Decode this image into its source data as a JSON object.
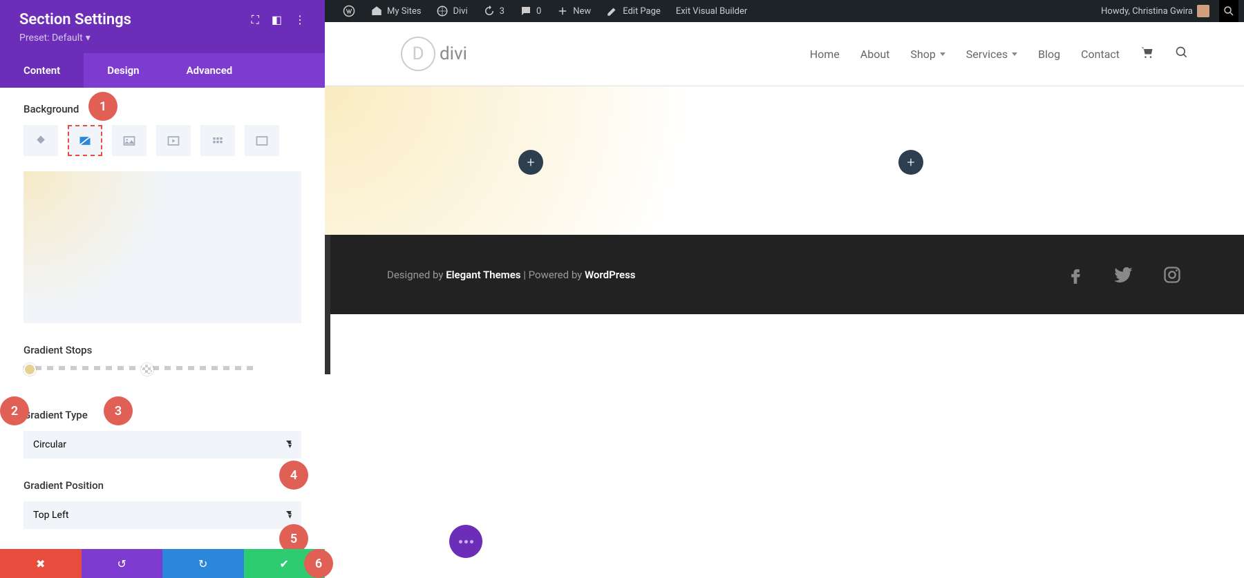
{
  "admin_bar": {
    "my_sites": "My Sites",
    "site_name": "Divi",
    "updates": "3",
    "comments": "0",
    "new": "New",
    "edit_page": "Edit Page",
    "exit_builder": "Exit Visual Builder",
    "greeting": "Howdy, Christina Gwira"
  },
  "panel": {
    "title": "Section Settings",
    "preset_label": "Preset: Default",
    "tabs": {
      "content": "Content",
      "design": "Design",
      "advanced": "Advanced"
    },
    "background_label": "Background",
    "gradient_stops_label": "Gradient Stops",
    "gradient_type_label": "Gradient Type",
    "gradient_type_value": "Circular",
    "gradient_position_label": "Gradient Position",
    "gradient_position_value": "Top Left",
    "badges": {
      "b1": "1",
      "b2": "2",
      "b3": "3",
      "b4": "4",
      "b5": "5",
      "b6": "6"
    }
  },
  "site": {
    "logo_letter": "D",
    "logo_text": "divi",
    "nav": {
      "home": "Home",
      "about": "About",
      "shop": "Shop",
      "services": "Services",
      "blog": "Blog",
      "contact": "Contact"
    },
    "footer_prefix": "Designed by ",
    "footer_et": "Elegant Themes",
    "footer_mid": " | Powered by ",
    "footer_wp": "WordPress",
    "plus": "+"
  }
}
